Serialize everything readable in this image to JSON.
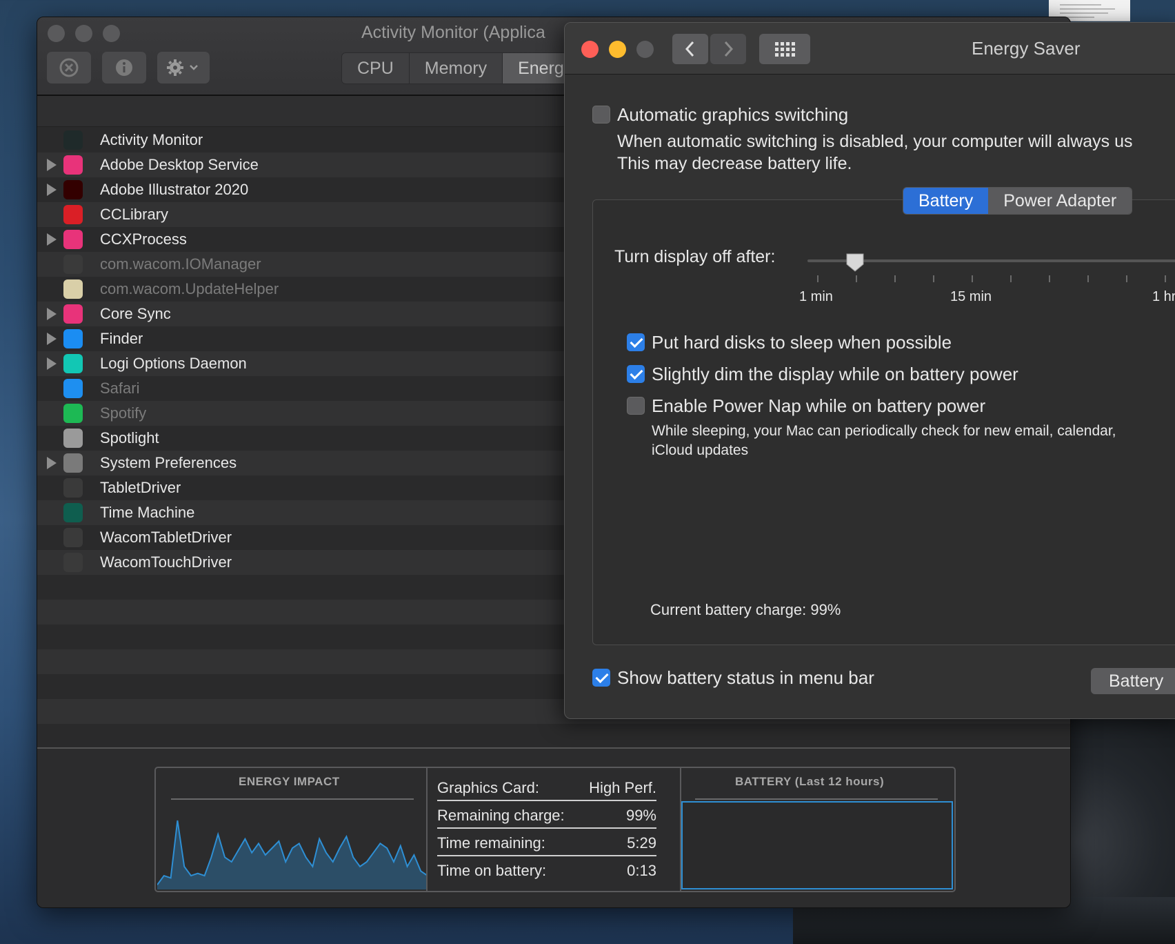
{
  "activity_monitor": {
    "title": "Activity Monitor (Applica",
    "tabs": [
      {
        "label": "CPU",
        "active": false
      },
      {
        "label": "Memory",
        "active": false
      },
      {
        "label": "Energ",
        "active": true
      }
    ],
    "processes": [
      {
        "name": "Activity Monitor",
        "expandable": false,
        "dimmed": false,
        "icon": "activity-monitor-icon",
        "color": "#1f2a2a"
      },
      {
        "name": "Adobe Desktop Service",
        "expandable": true,
        "dimmed": false,
        "icon": "creative-cloud-icon",
        "color": "#e8337a"
      },
      {
        "name": "Adobe Illustrator 2020",
        "expandable": true,
        "dimmed": false,
        "icon": "illustrator-icon",
        "color": "#330000"
      },
      {
        "name": "CCLibrary",
        "expandable": false,
        "dimmed": false,
        "icon": "cc-library-icon",
        "color": "#da1f26"
      },
      {
        "name": "CCXProcess",
        "expandable": true,
        "dimmed": false,
        "icon": "creative-cloud-icon",
        "color": "#e8337a"
      },
      {
        "name": "com.wacom.IOManager",
        "expandable": false,
        "dimmed": true,
        "icon": "wacom-icon",
        "color": "#3a3a3a"
      },
      {
        "name": "com.wacom.UpdateHelper",
        "expandable": false,
        "dimmed": true,
        "icon": "wacom-updater-icon",
        "color": "#d9cfa8"
      },
      {
        "name": "Core Sync",
        "expandable": true,
        "dimmed": false,
        "icon": "creative-cloud-icon",
        "color": "#e8337a"
      },
      {
        "name": "Finder",
        "expandable": true,
        "dimmed": false,
        "icon": "finder-icon",
        "color": "#1b8df2"
      },
      {
        "name": "Logi Options Daemon",
        "expandable": true,
        "dimmed": false,
        "icon": "logi-icon",
        "color": "#12c7b4"
      },
      {
        "name": "Safari",
        "expandable": false,
        "dimmed": true,
        "icon": "safari-icon",
        "color": "#1e8ff0"
      },
      {
        "name": "Spotify",
        "expandable": false,
        "dimmed": true,
        "icon": "spotify-icon",
        "color": "#1db954"
      },
      {
        "name": "Spotlight",
        "expandable": false,
        "dimmed": false,
        "icon": "spotlight-icon",
        "color": "#9a9a9a"
      },
      {
        "name": "System Preferences",
        "expandable": true,
        "dimmed": false,
        "icon": "system-preferences-icon",
        "color": "#7a7a7a"
      },
      {
        "name": "TabletDriver",
        "expandable": false,
        "dimmed": false,
        "icon": "wacom-icon",
        "color": "#3a3a3a"
      },
      {
        "name": "Time Machine",
        "expandable": false,
        "dimmed": false,
        "icon": "time-machine-icon",
        "color": "#0f5e4f"
      },
      {
        "name": "WacomTabletDriver",
        "expandable": false,
        "dimmed": false,
        "icon": "wacom-icon",
        "color": "#3a3a3a"
      },
      {
        "name": "WacomTouchDriver",
        "expandable": false,
        "dimmed": false,
        "icon": "wacom-icon",
        "color": "#3a3a3a"
      }
    ],
    "footer": {
      "energy_impact_title": "ENERGY IMPACT",
      "battery_title": "BATTERY (Last 12 hours)",
      "stats": [
        {
          "label": "Graphics Card:",
          "value": "High Perf."
        },
        {
          "label": "Remaining charge:",
          "value": "99%"
        },
        {
          "label": "Time remaining:",
          "value": "5:29"
        },
        {
          "label": "Time on battery:",
          "value": "0:13"
        }
      ],
      "energy_series": [
        2,
        6,
        5,
        30,
        10,
        6,
        7,
        6,
        14,
        24,
        14,
        12,
        17,
        22,
        16,
        20,
        15,
        18,
        21,
        12,
        18,
        20,
        14,
        10,
        22,
        16,
        12,
        18,
        23,
        14,
        10,
        12,
        16,
        20,
        18,
        12,
        19,
        10,
        15,
        8,
        6
      ],
      "accent_color": "#2e8fd4"
    }
  },
  "energy_saver": {
    "title": "Energy Saver",
    "auto_switch_label": "Automatic graphics switching",
    "auto_switch_checked": false,
    "auto_switch_desc_1": "When automatic switching is disabled, your computer will always us",
    "auto_switch_desc_2": "This may decrease battery life.",
    "tabs": [
      {
        "label": "Battery",
        "active": true
      },
      {
        "label": "Power Adapter",
        "active": false
      }
    ],
    "display_off_label": "Turn display off after:",
    "slider_labels": [
      "1 min",
      "15 min",
      "1 hr"
    ],
    "options": [
      {
        "label": "Put hard disks to sleep when possible",
        "checked": true
      },
      {
        "label": "Slightly dim the display while on battery power",
        "checked": true
      },
      {
        "label": "Enable Power Nap while on battery power",
        "checked": false
      }
    ],
    "power_nap_desc_1": "While sleeping, your Mac can periodically check for new email, calendar,",
    "power_nap_desc_2": "iCloud updates",
    "battery_charge": "Current battery charge: 99%",
    "show_battery_label": "Show battery status in menu bar",
    "show_battery_checked": true,
    "battery_button": "Battery",
    "accent_color": "#2c7fe8"
  }
}
